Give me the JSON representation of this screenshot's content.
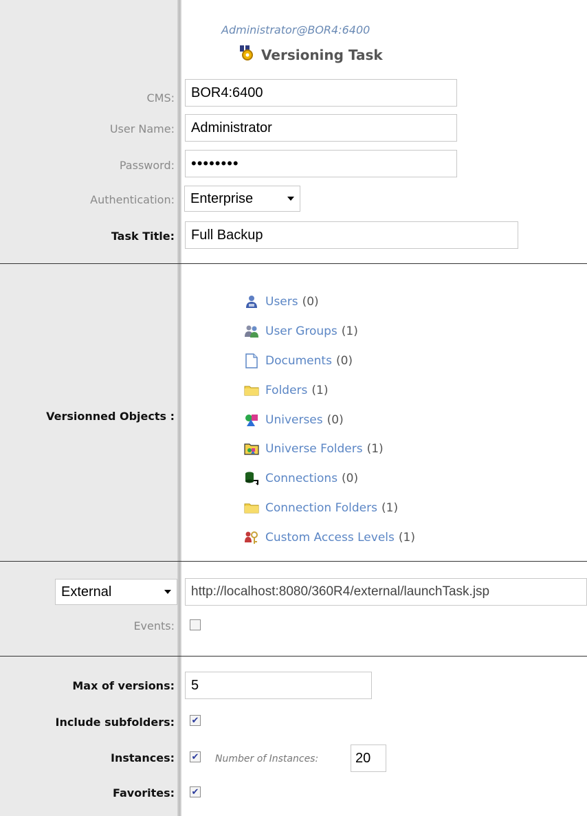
{
  "header": {
    "user": "Administrator@BOR4:6400",
    "task_title": "Versioning Task"
  },
  "login": {
    "cms_label": "CMS:",
    "cms_value": "BOR4:6400",
    "username_label": "User Name:",
    "username_value": "Administrator",
    "password_label": "Password:",
    "password_value": "••••••••",
    "auth_label": "Authentication:",
    "auth_value": "Enterprise",
    "tasktitle_label": "Task Title:",
    "tasktitle_value": "Full Backup"
  },
  "versioned": {
    "label": "Versionned Objects :",
    "items": [
      {
        "name": "Users",
        "count": "(0)",
        "icon": "user-icon"
      },
      {
        "name": "User Groups",
        "count": "(1)",
        "icon": "user-group-icon"
      },
      {
        "name": "Documents",
        "count": "(0)",
        "icon": "document-icon"
      },
      {
        "name": "Folders",
        "count": "(1)",
        "icon": "folder-icon"
      },
      {
        "name": "Universes",
        "count": "(0)",
        "icon": "universe-icon"
      },
      {
        "name": "Universe Folders",
        "count": "(1)",
        "icon": "universe-folder-icon"
      },
      {
        "name": "Connections",
        "count": "(0)",
        "icon": "connection-icon"
      },
      {
        "name": "Connection Folders",
        "count": "(1)",
        "icon": "connection-folder-icon"
      },
      {
        "name": "Custom Access Levels",
        "count": "(1)",
        "icon": "access-level-icon"
      }
    ]
  },
  "launch": {
    "mode_value": "External",
    "url_value": "http://localhost:8080/360R4/external/launchTask.jsp",
    "events_label": "Events:",
    "events_checked": false
  },
  "options": {
    "max_versions_label": "Max of versions:",
    "max_versions_value": "5",
    "include_subfolders_label": "Include subfolders:",
    "include_subfolders_checked": true,
    "instances_label": "Instances:",
    "instances_checked": true,
    "num_instances_label": "Number of Instances:",
    "num_instances_value": "20",
    "favorites_label": "Favorites:",
    "favorites_checked": true
  },
  "colors": {
    "link": "#5b86c5",
    "left_pane": "#eaeaea",
    "label_gray": "#8a8a8a"
  }
}
